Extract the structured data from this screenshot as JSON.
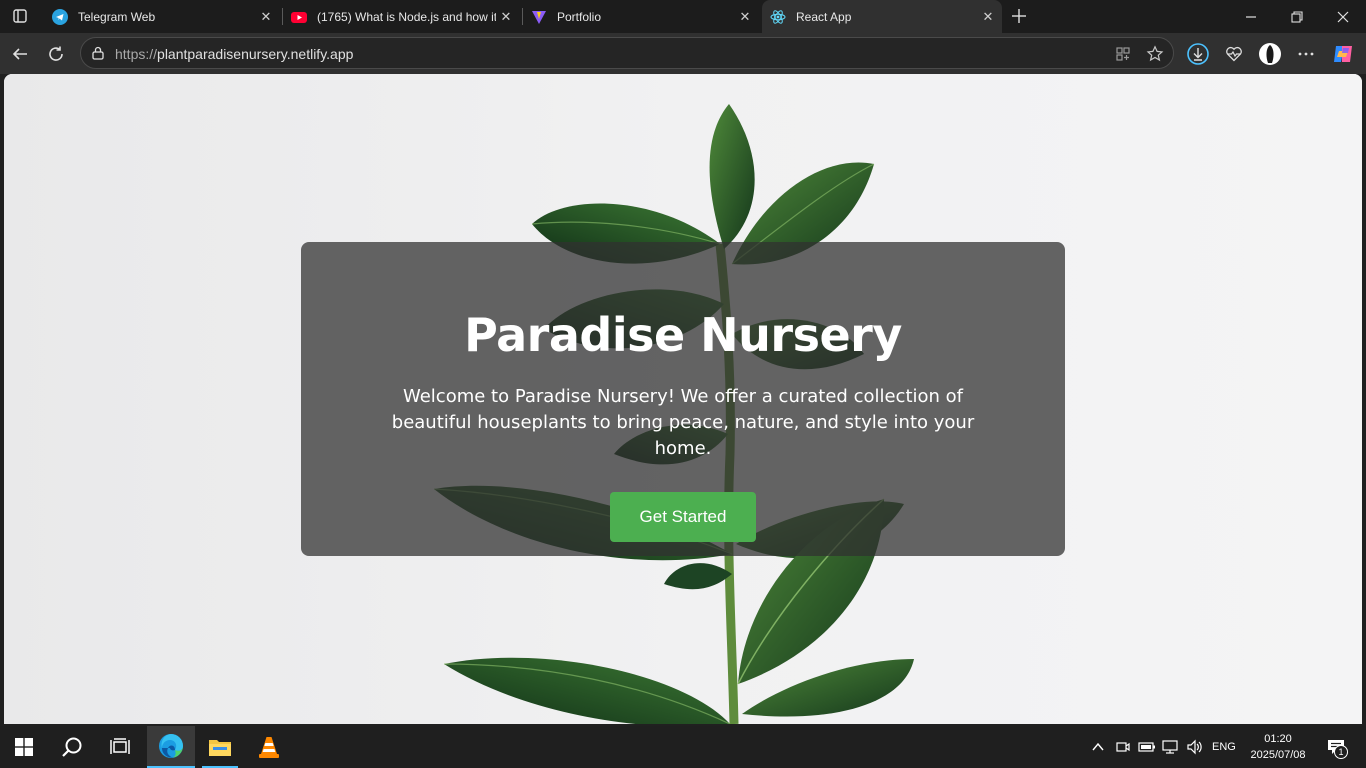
{
  "browser": {
    "tabs": [
      {
        "title": "Telegram Web",
        "icon": "telegram-icon",
        "active": false
      },
      {
        "title": "(1765) What is Node.js and how it",
        "icon": "youtube-icon",
        "active": false
      },
      {
        "title": "Portfolio",
        "icon": "vite-icon",
        "active": false
      },
      {
        "title": "React App",
        "icon": "react-icon",
        "active": true
      }
    ],
    "url_protocol": "https://",
    "url_host": "plantparadisenursery.netlify.app"
  },
  "page": {
    "title": "Paradise Nursery",
    "description": "Welcome to Paradise Nursery! We offer a curated collection of beautiful houseplants to bring peace, nature, and style into your home.",
    "cta_label": "Get Started",
    "cta_color": "#4caf50"
  },
  "taskbar": {
    "apps": [
      "start-icon",
      "search-icon",
      "task-view-icon",
      "edge-icon",
      "file-explorer-icon",
      "vlc-icon"
    ],
    "language": "ENG",
    "time": "01:20",
    "date": "2025/07/08",
    "notification_count": "1"
  }
}
